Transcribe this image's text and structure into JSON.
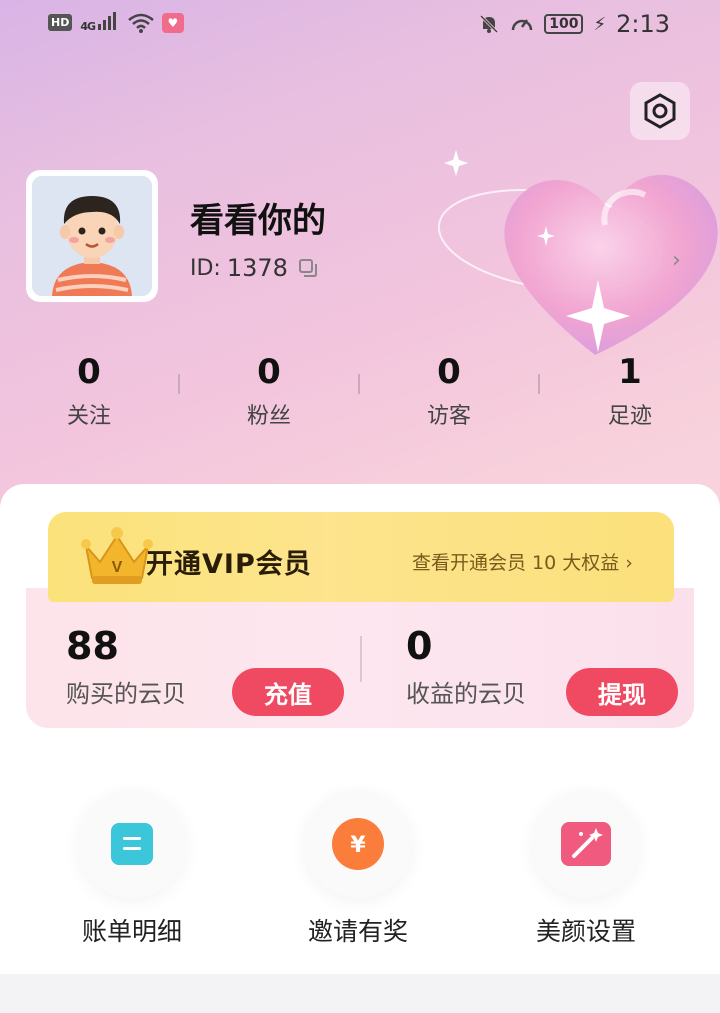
{
  "status_bar": {
    "network": "4G",
    "battery": "100",
    "time": "2:13"
  },
  "profile": {
    "username": "看看你的",
    "id_label": "ID:",
    "id_value": "1378"
  },
  "stats": [
    {
      "value": "0",
      "label": "关注"
    },
    {
      "value": "0",
      "label": "粉丝"
    },
    {
      "value": "0",
      "label": "访客"
    },
    {
      "value": "1",
      "label": "足迹"
    }
  ],
  "vip": {
    "title": "开通VIP会员",
    "link": "查看开通会员 10 大权益 ›"
  },
  "wallet": {
    "purchased_value": "88",
    "purchased_label": "购买的云贝",
    "recharge_button": "充值",
    "earned_value": "0",
    "earned_label": "收益的云贝",
    "withdraw_button": "提现"
  },
  "features": [
    {
      "label": "账单明细",
      "icon": "bill-icon"
    },
    {
      "label": "邀请有奖",
      "icon": "yen-coin-icon"
    },
    {
      "label": "美颜设置",
      "icon": "magic-wand-icon"
    }
  ],
  "colors": {
    "accent_red": "#f04a63",
    "vip_gold": "#fbe27a",
    "bill_teal": "#3cc6d9",
    "coin_orange": "#fb7d3c",
    "beauty_pink": "#f05a7e"
  }
}
